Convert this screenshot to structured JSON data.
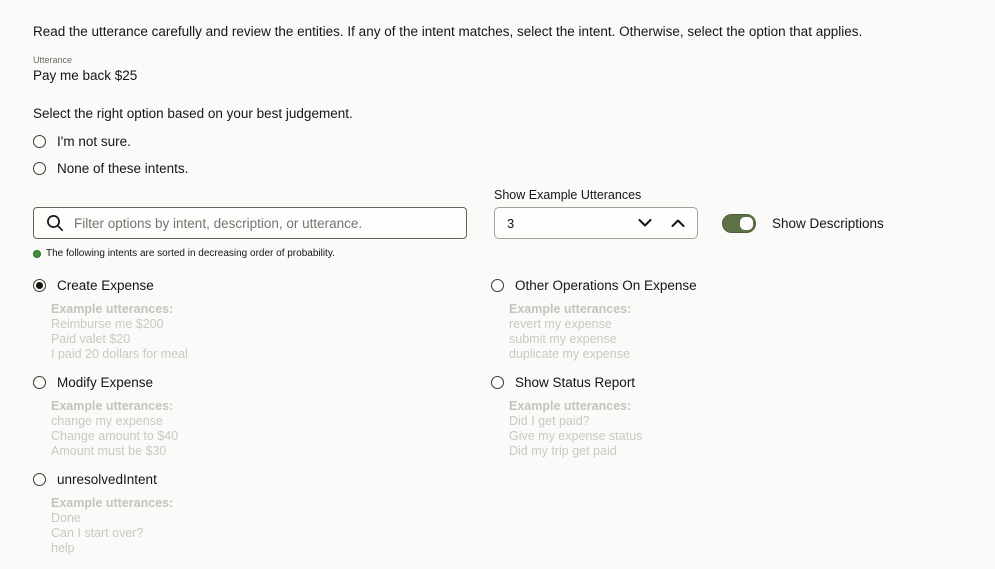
{
  "page": {
    "instruction": "Read the utterance carefully and review the entities. If any of the intent matches, select the intent. Otherwise, select the option that applies.",
    "utterance_label": "Utterance",
    "utterance_value": "Pay me back $25",
    "prompt": "Select the right option based on your best judgement.",
    "note": "The following intents are sorted in decreasing order of probability."
  },
  "fallback_options": [
    {
      "label": "I'm not sure.",
      "selected": false
    },
    {
      "label": "None of these intents.",
      "selected": false
    }
  ],
  "filter": {
    "placeholder": "Filter options by intent, description, or utterance.",
    "value": ""
  },
  "show_example_utterances": {
    "label": "Show Example Utterances",
    "value": "3"
  },
  "show_descriptions": {
    "label": "Show Descriptions",
    "enabled": true
  },
  "examples_header": "Example utterances:",
  "columns": {
    "left": [
      {
        "label": "Create Expense",
        "selected": true,
        "examples": [
          "Reimburse me $200",
          "Paid valet $20",
          "I paid 20 dollars for meal"
        ]
      },
      {
        "label": "Modify Expense",
        "selected": false,
        "examples": [
          "change my expense",
          "Change amount to $40",
          "Amount must be $30"
        ]
      },
      {
        "label": "unresolvedIntent",
        "selected": false,
        "examples": [
          "Done",
          "Can I start over?",
          "help"
        ]
      }
    ],
    "right": [
      {
        "label": "Other Operations On Expense",
        "selected": false,
        "examples": [
          "revert my expense",
          "submit my expense",
          "duplicate my expense"
        ]
      },
      {
        "label": "Show Status Report",
        "selected": false,
        "examples": [
          "Did I get paid?",
          "Give my expense status",
          "Did my trip get paid"
        ]
      }
    ]
  },
  "icons": {
    "search": "search-icon",
    "chevron_down": "chevron-down-icon",
    "chevron_up": "chevron-up-icon",
    "info_dot": "info-dot-icon"
  },
  "colors": {
    "accent_green": "#5d7346",
    "note_green": "#3f8f3f",
    "text": "#161513",
    "muted_example_text": "#c9c8c3",
    "search_border": "#64635a"
  }
}
